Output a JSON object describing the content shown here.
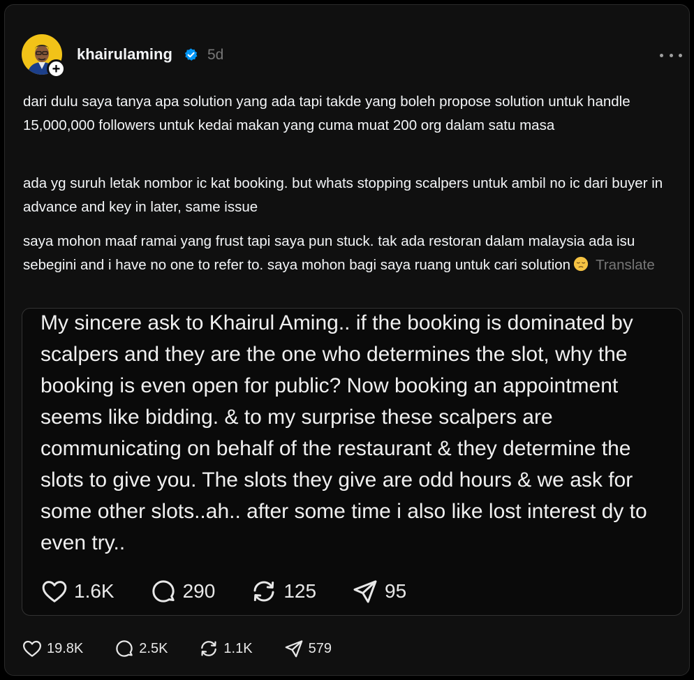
{
  "post": {
    "username": "khairulaming",
    "timestamp": "5d",
    "paragraphs": [
      "dari dulu saya tanya apa solution yang ada tapi takde yang boleh propose solution untuk handle 15,000,000 followers untuk kedai makan yang cuma muat 200 org dalam satu masa",
      "ada yg suruh letak nombor ic kat booking. but whats stopping scalpers untuk ambil no ic dari buyer in advance and key in later, same issue",
      "saya mohon maaf ramai yang frust tapi saya pun stuck. tak ada restoran dalam malaysia ada isu sebegini and i have no one to refer to. saya mohon bagi saya ruang untuk cari solution"
    ],
    "emoji": "pensive-face",
    "translate_label": "Translate",
    "quoted": {
      "text": "My sincere ask to Khairul Aming.. if the booking is dominated by scalpers and they are the one who determines the slot, why the booking is even open for public? Now booking an appointment seems like bidding. & to my surprise these scalpers are communicating on behalf of the restaurant & they determine the slots to give you. The slots they give are odd hours & we ask for some other slots..ah.. after some time i also like lost interest dy to even try..",
      "likes": "1.6K",
      "replies": "290",
      "reposts": "125",
      "shares": "95"
    },
    "likes": "19.8K",
    "replies": "2.5K",
    "reposts": "1.1K",
    "shares": "579"
  },
  "colors": {
    "background": "#101010",
    "text": "#f3f5f7",
    "muted": "#777777",
    "verified": "#0095f6"
  }
}
